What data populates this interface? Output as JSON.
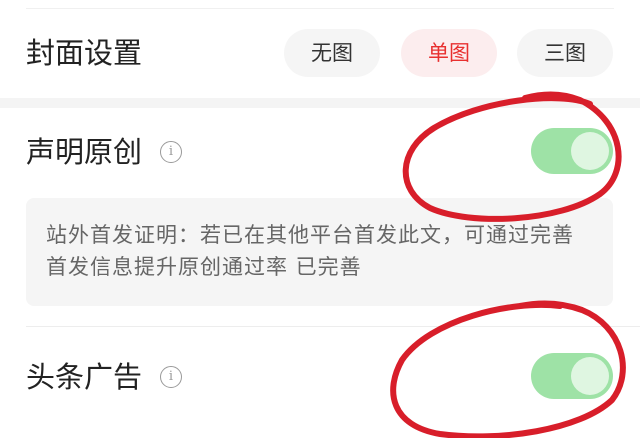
{
  "cover": {
    "title": "封面设置",
    "options": [
      {
        "label": "无图",
        "selected": false
      },
      {
        "label": "单图",
        "selected": true
      },
      {
        "label": "三图",
        "selected": false
      }
    ]
  },
  "original": {
    "label": "声明原创",
    "info_icon": "info-icon",
    "enabled": true,
    "note": "站外首发证明：若已在其他平台首发此文，可通过完善首发信息提升原创通过率 已完善"
  },
  "ads": {
    "label": "头条广告",
    "info_icon": "info-icon",
    "enabled": true
  },
  "colors": {
    "accent": "#e8302f",
    "selected_bg": "#fcedee",
    "toggle_on": "#9ee2a6",
    "annotation": "#d81e2a"
  }
}
